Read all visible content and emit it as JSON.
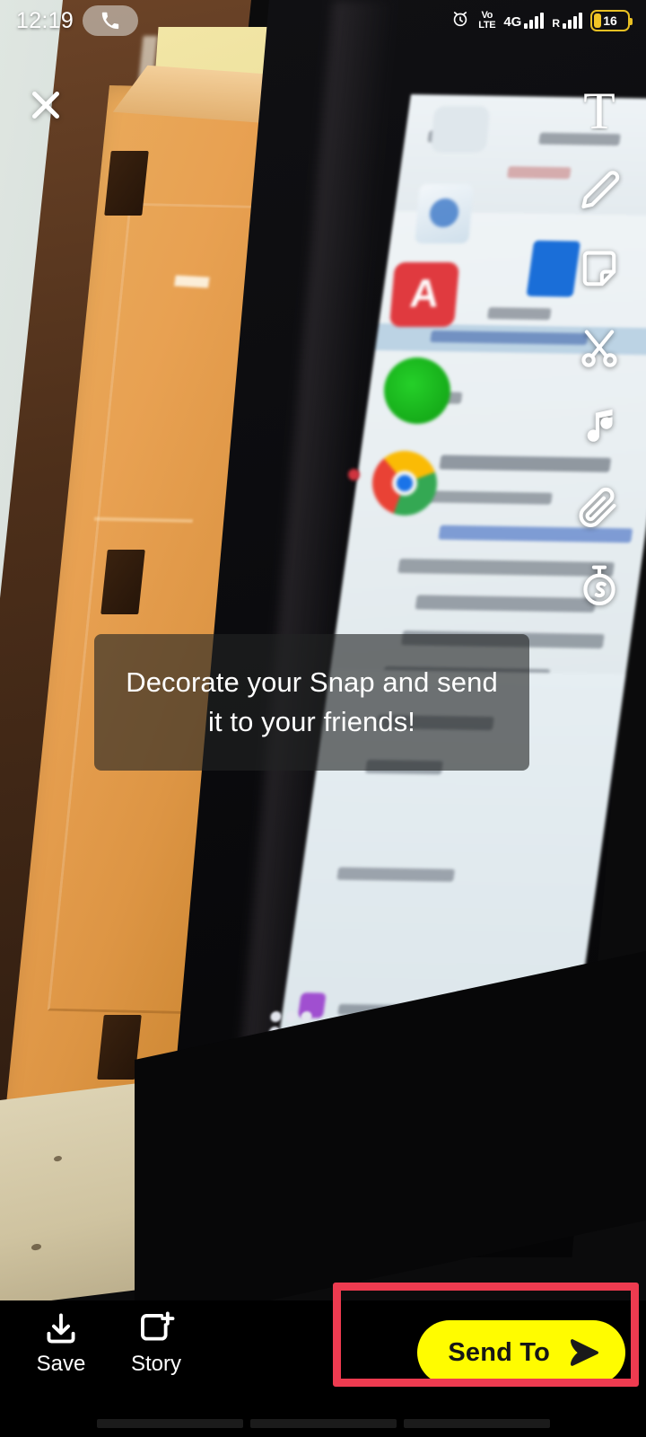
{
  "status_bar": {
    "clock": "12:19",
    "call_icon": "phone-icon",
    "alarm_icon": "alarm-clock-icon",
    "volte_top": "Vo",
    "volte_bottom": "LTE",
    "network_label": "4G",
    "roaming_label": "R",
    "battery_percent": "16"
  },
  "overlay": {
    "close_icon": "close-x-icon"
  },
  "toolbar": {
    "items": [
      {
        "name": "text-tool",
        "icon": "text-t-icon",
        "glyph": "T"
      },
      {
        "name": "draw-tool",
        "icon": "pencil-icon"
      },
      {
        "name": "sticker-tool",
        "icon": "sticker-icon"
      },
      {
        "name": "cutout-tool",
        "icon": "scissors-icon"
      },
      {
        "name": "music-tool",
        "icon": "music-note-icon"
      },
      {
        "name": "attach-tool",
        "icon": "paperclip-icon"
      },
      {
        "name": "timer-tool",
        "icon": "stopwatch-icon"
      }
    ]
  },
  "tooltip": {
    "line1": "Decorate your Snap and send",
    "line2": "it to your friends!"
  },
  "bottom_bar": {
    "save": {
      "label": "Save",
      "icon": "download-icon"
    },
    "story": {
      "label": "Story",
      "icon": "add-to-story-icon"
    },
    "send_to": {
      "label": "Send To",
      "icon": "send-arrow-icon"
    }
  },
  "annotation": {
    "highlight_color": "#ee3b50",
    "target": "send-to-button"
  },
  "colors": {
    "snap_yellow": "#fffc00",
    "bar_black": "#000000",
    "annotation_red": "#ee3b50",
    "battery_yellow": "#f1c526"
  },
  "photo": {
    "app_red_letter": "A"
  }
}
